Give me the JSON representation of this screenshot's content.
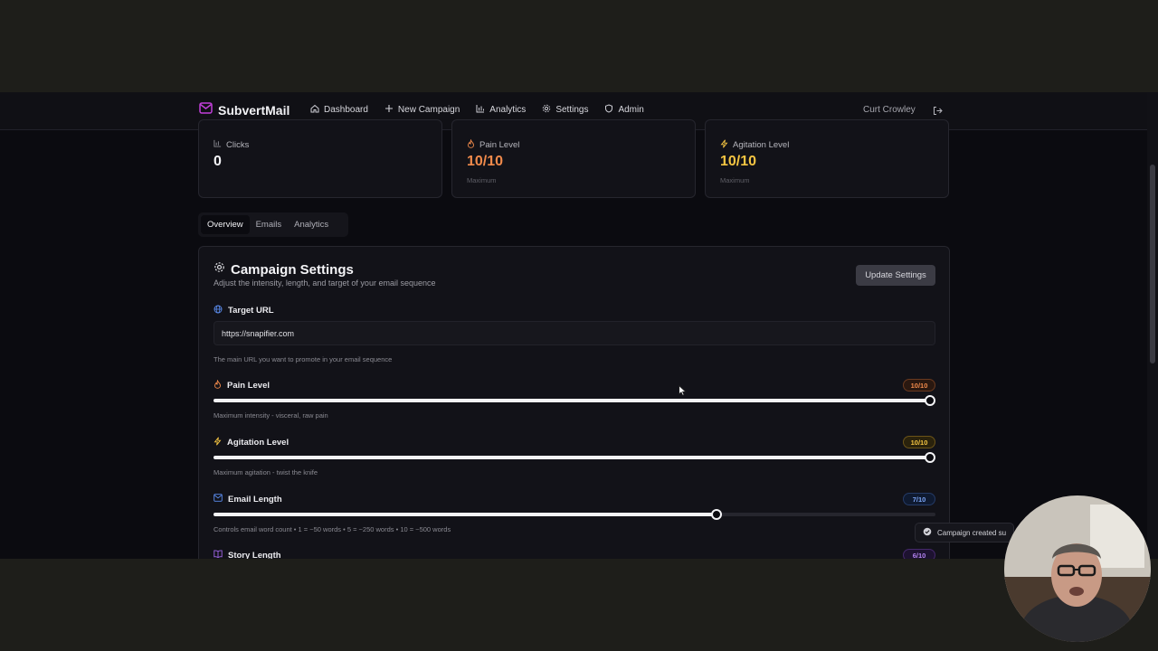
{
  "app": {
    "name": "SubvertMail"
  },
  "nav": {
    "items": [
      {
        "label": "Dashboard",
        "icon": "home-icon"
      },
      {
        "label": "New Campaign",
        "icon": "plus-icon"
      },
      {
        "label": "Analytics",
        "icon": "bar-chart-icon"
      },
      {
        "label": "Settings",
        "icon": "gear-icon"
      },
      {
        "label": "Admin",
        "icon": "shield-icon"
      }
    ]
  },
  "user": {
    "name": "Curt Crowley"
  },
  "stats": [
    {
      "label": "Clicks",
      "value": "0",
      "sub": "",
      "color": "#f2f2f5"
    },
    {
      "label": "Pain Level",
      "value": "10/10",
      "sub": "Maximum",
      "color": "#f08a4b"
    },
    {
      "label": "Agitation Level",
      "value": "10/10",
      "sub": "Maximum",
      "color": "#f5c542"
    }
  ],
  "tabs": {
    "items": [
      "Overview",
      "Emails",
      "Analytics"
    ],
    "active": "Overview"
  },
  "settings": {
    "title": "Campaign Settings",
    "subtitle": "Adjust the intensity, length, and target of your email sequence",
    "update_label": "Update Settings",
    "target_url": {
      "label": "Target URL",
      "value": "https://snapifier.com",
      "hint": "The main URL you want to promote in your email sequence"
    },
    "pain": {
      "label": "Pain Level",
      "badge": "10/10",
      "value": 10,
      "max": 10,
      "hint": "Maximum intensity - visceral, raw pain",
      "color": "#f08a4b"
    },
    "agitation": {
      "label": "Agitation Level",
      "badge": "10/10",
      "value": 10,
      "max": 10,
      "hint": "Maximum agitation - twist the knife",
      "color": "#f5c542"
    },
    "email_length": {
      "label": "Email Length",
      "badge": "7/10",
      "value": 7,
      "max": 10,
      "hint": "Controls email word count • 1 = ~50 words • 5 = ~250 words • 10 = ~500 words",
      "color": "#5b8def"
    },
    "story_length": {
      "label": "Story Length",
      "badge": "6/10",
      "value": 6,
      "max": 10,
      "color": "#a066e8"
    }
  },
  "toast": {
    "text": "Campaign created su"
  },
  "colors": {
    "accent": "#c13fd9",
    "background": "#0b0b10"
  }
}
